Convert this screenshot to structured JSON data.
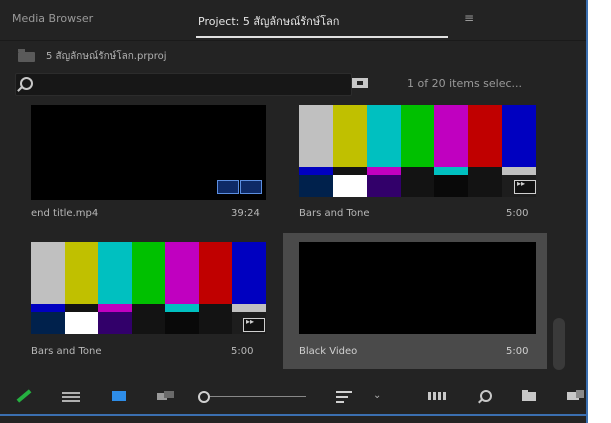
{
  "tabs": {
    "media_browser": "Media Browser",
    "project": "Project: 5 สัญลักษณ์รักษ์โลก",
    "menu_glyph": "≡"
  },
  "project_path": "5 สัญลักษณ์รักษ์โลก.prproj",
  "search": {
    "value": "",
    "placeholder": ""
  },
  "item_count": "1 of 20 items selec...",
  "items": [
    {
      "name": "end title.mp4",
      "duration": "39:24",
      "thumbnail": "black",
      "selected": false
    },
    {
      "name": "Bars and Tone",
      "duration": "5:00",
      "thumbnail": "color-bars",
      "selected": false
    },
    {
      "name": "Bars and Tone",
      "duration": "5:00",
      "thumbnail": "color-bars",
      "selected": false
    },
    {
      "name": "Black Video",
      "duration": "5:00",
      "thumbnail": "black",
      "selected": true
    }
  ],
  "colors": {
    "panel_bg": "#232323",
    "accent_blue": "#2e8de8",
    "pencil_green": "#25b040",
    "bars_top": [
      "#c0c0c0",
      "#c0c000",
      "#00c0c0",
      "#00c000",
      "#c000c0",
      "#c00000",
      "#0000c0"
    ],
    "bars_mid": [
      "#0000c0",
      "#131313",
      "#c000c0",
      "#131313",
      "#00c0c0",
      "#131313",
      "#c0c0c0"
    ],
    "bars_bottom": [
      "#00214c",
      "#ffffff",
      "#32006a",
      "#131313",
      "#090909",
      "#131313",
      "#1d1d1d"
    ]
  },
  "toolbar_icons": [
    "pencil-icon",
    "list-view-icon",
    "icon-view-icon",
    "freeform-view-icon",
    "zoom-slider",
    "sort-icon",
    "chevron-down-icon",
    "automate-to-sequence-icon",
    "find-icon",
    "new-bin-icon",
    "new-item-icon"
  ]
}
